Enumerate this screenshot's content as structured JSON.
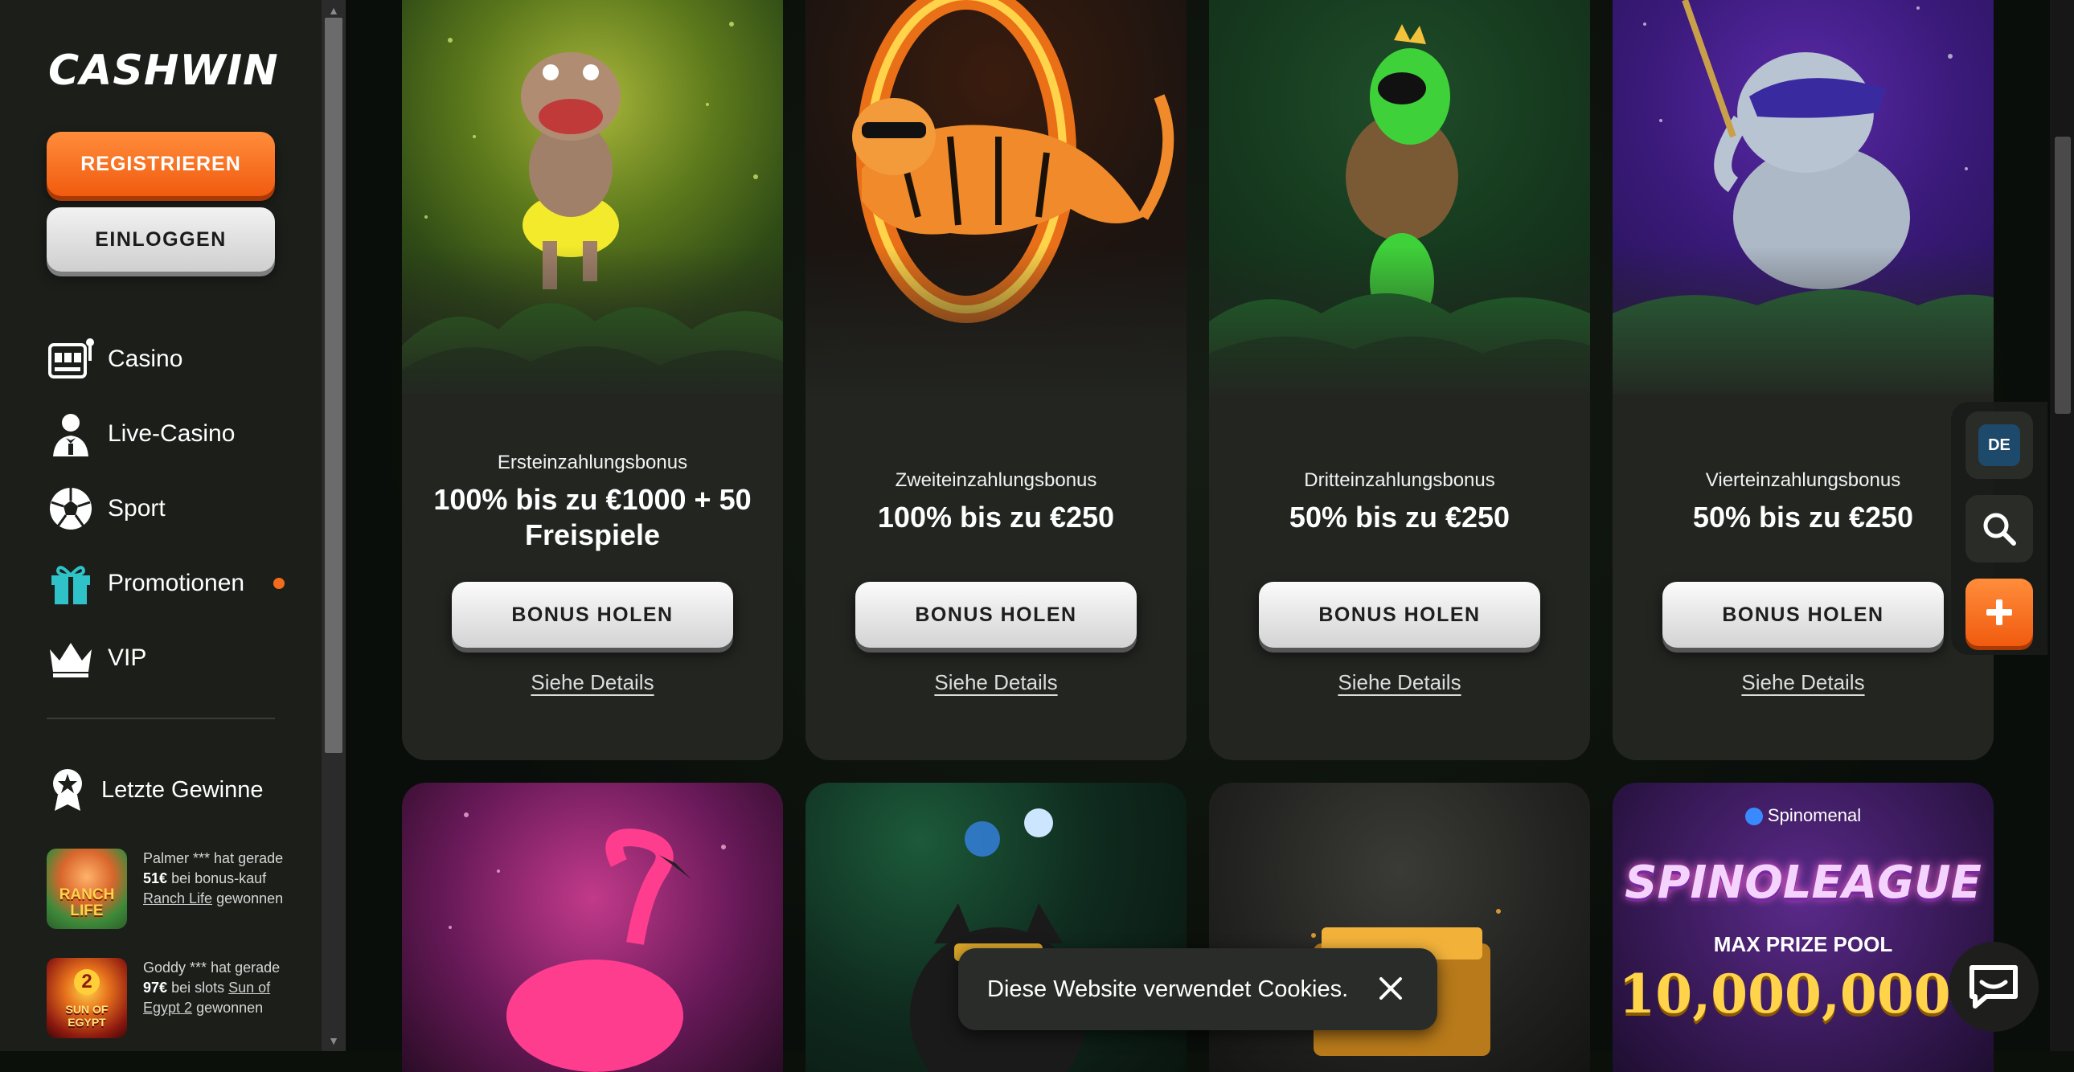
{
  "brand": {
    "logo_text": "CASHWIN"
  },
  "auth": {
    "register_label": "REGISTRIEREN",
    "login_label": "EINLOGGEN"
  },
  "nav": [
    {
      "label": "Casino",
      "icon": "slot-machine-icon"
    },
    {
      "label": "Live-Casino",
      "icon": "dealer-icon"
    },
    {
      "label": "Sport",
      "icon": "soccer-ball-icon"
    },
    {
      "label": "Promotionen",
      "icon": "gift-icon",
      "badge": "notification-dot"
    },
    {
      "label": "VIP",
      "icon": "crown-icon"
    }
  ],
  "recent_wins": {
    "title": "Letzte Gewinne",
    "items": [
      {
        "player": "Palmer ***",
        "pre": "hat gerade",
        "amount": "51€",
        "mid": "bei bonus-kauf",
        "game": "Ranch Life",
        "post": "gewonnen",
        "thumb_label": "RANCH LIFE"
      },
      {
        "player": "Goddy ***",
        "pre": "hat gerade",
        "amount": "97€",
        "mid": "bei slots",
        "game": "Sun of Egypt 2",
        "post": "gewonnen",
        "thumb_label": "SUN OF EGYPT"
      }
    ]
  },
  "bonus_cards": [
    {
      "subtitle": "Ersteinzahlungsbonus",
      "title": "100% bis zu €1000 + 50 Freispiele",
      "button": "BONUS HOLEN",
      "details": "Siehe Details",
      "art": "hippo-dancer"
    },
    {
      "subtitle": "Zweiteinzahlungsbonus",
      "title": "100% bis zu €250",
      "button": "BONUS HOLEN",
      "details": "Siehe Details",
      "art": "tiger-fire-ring"
    },
    {
      "subtitle": "Dritteinzahlungsbonus",
      "title": "50% bis zu €250",
      "button": "BONUS HOLEN",
      "details": "Siehe Details",
      "art": "turtle-guitar"
    },
    {
      "subtitle": "Vierteinzahlungsbonus",
      "title": "50% bis zu €250",
      "button": "BONUS HOLEN",
      "details": "Siehe Details",
      "art": "elephant-sunglasses"
    }
  ],
  "promo_cards": [
    {
      "art": "flamingo"
    },
    {
      "art": "panther"
    },
    {
      "art": "treasure-chest"
    },
    {
      "art": "spinoleague",
      "provider": "Spinomenal",
      "headline": "SPINOLEAGUE",
      "prize_label": "MAX PRIZE POOL",
      "prize_value": "10,000,000€"
    }
  ],
  "tools": {
    "language": "DE",
    "search": "search-icon",
    "more": "plus-icon"
  },
  "cookie": {
    "text": "Diese Website verwendet Cookies."
  },
  "colors": {
    "accent": "#f36c1b",
    "sidebar": "#1c1e1a",
    "card": "#232521"
  }
}
